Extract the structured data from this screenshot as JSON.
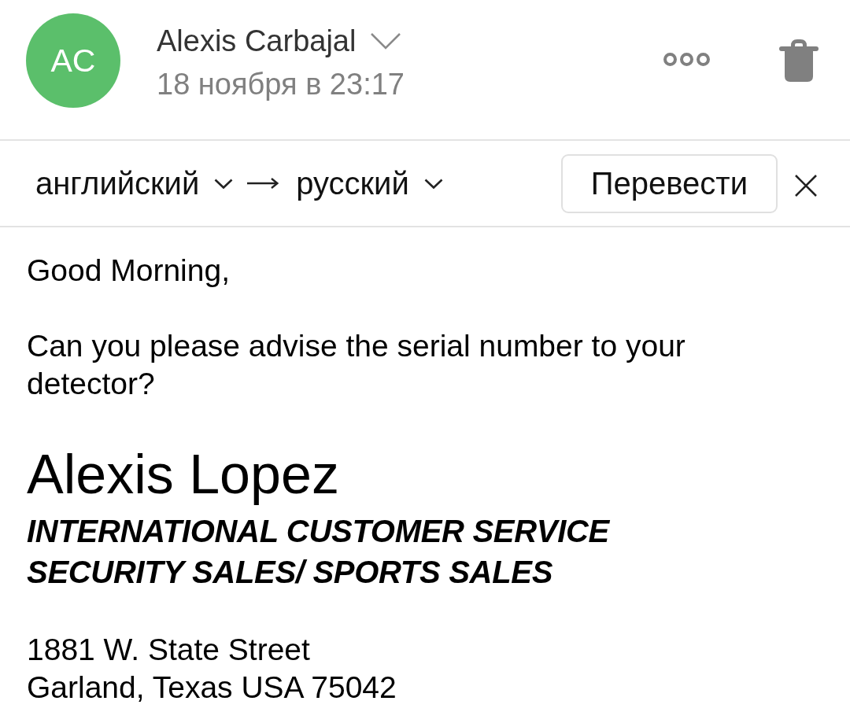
{
  "header": {
    "avatar": {
      "initials": "AC"
    },
    "sender": "Alexis Carbajal",
    "date": "18 ноября в 23:17"
  },
  "translate_bar": {
    "source_language": "английский",
    "target_language": "русский",
    "button": "Перевести"
  },
  "body": {
    "paragraphs": [
      "Good Morning,",
      "Can you please advise the serial number to your detector?"
    ],
    "signature": {
      "name": "Alexis Lopez",
      "titles": [
        "INTERNATIONAL CUSTOMER SERVICE",
        "SECURITY SALES/ SPORTS SALES"
      ],
      "address": [
        "1881 W. State Street",
        "Garland, Texas USA 75042"
      ]
    }
  }
}
